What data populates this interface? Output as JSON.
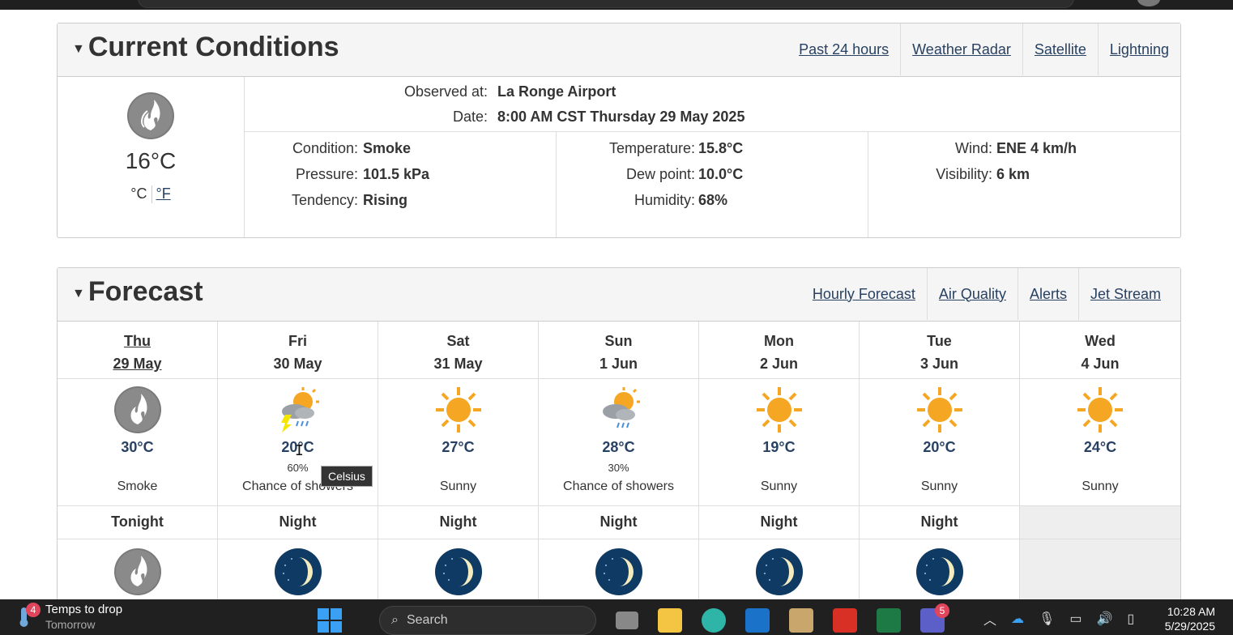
{
  "current": {
    "title": "Current Conditions",
    "links": [
      "Past 24 hours",
      "Weather Radar",
      "Satellite",
      "Lightning"
    ],
    "temp": "16°C",
    "unit_c": "°C",
    "unit_f": "°F",
    "observed_label": "Observed at:",
    "observed_value": "La Ronge Airport",
    "date_label": "Date:",
    "date_value": "8:00 AM CST Thursday 29 May 2025",
    "col1": [
      {
        "label": "Condition:",
        "value": "Smoke"
      },
      {
        "label": "Pressure:",
        "value": "101.5 kPa"
      },
      {
        "label": "Tendency:",
        "value": "Rising"
      }
    ],
    "col2": [
      {
        "label": "Temperature:",
        "value": "15.8°C"
      },
      {
        "label": "Dew point:",
        "value": "10.0°C"
      },
      {
        "label": "Humidity:",
        "value": "68%"
      }
    ],
    "col3": [
      {
        "label": "Wind:",
        "value": "ENE 4 km/h"
      },
      {
        "label": "Visibility:",
        "value": "6 km"
      }
    ]
  },
  "forecast": {
    "title": "Forecast",
    "links": [
      "Hourly Forecast",
      "Air Quality",
      "Alerts",
      "Jet Stream"
    ],
    "days": [
      {
        "day": "Thu",
        "date": "29 May",
        "icon": "smoke-icon",
        "temp": "30°C",
        "pop": "",
        "cond": "Smoke"
      },
      {
        "day": "Fri",
        "date": "30 May",
        "icon": "thunder-showers-icon",
        "temp": "20°C",
        "pop": "60%",
        "cond": "Chance of showers"
      },
      {
        "day": "Sat",
        "date": "31 May",
        "icon": "sun-icon",
        "temp": "27°C",
        "pop": "",
        "cond": "Sunny"
      },
      {
        "day": "Sun",
        "date": "1 Jun",
        "icon": "sun-showers-icon",
        "temp": "28°C",
        "pop": "30%",
        "cond": "Chance of showers"
      },
      {
        "day": "Mon",
        "date": "2 Jun",
        "icon": "sun-icon",
        "temp": "19°C",
        "pop": "",
        "cond": "Sunny"
      },
      {
        "day": "Tue",
        "date": "3 Jun",
        "icon": "sun-icon",
        "temp": "20°C",
        "pop": "",
        "cond": "Sunny"
      },
      {
        "day": "Wed",
        "date": "4 Jun",
        "icon": "sun-icon",
        "temp": "24°C",
        "pop": "",
        "cond": "Sunny"
      }
    ],
    "nights": [
      "Tonight",
      "Night",
      "Night",
      "Night",
      "Night",
      "Night",
      ""
    ],
    "night_icons": [
      "smoke-icon",
      "moon-icon",
      "moon-icon",
      "moon-icon",
      "moon-icon",
      "moon-icon",
      ""
    ],
    "tooltip": "Celsius"
  },
  "taskbar": {
    "widget_badge": "4",
    "widget_title": "Temps to drop",
    "widget_sub": "Tomorrow",
    "search": "Search",
    "teams_badge": "5",
    "time": "10:28 AM",
    "date": "5/29/2025"
  },
  "colors": {
    "accent_link": "#284162",
    "sun": "#F5A623",
    "moon_bg": "#0E3A63",
    "smoke": "#7a7a7a"
  }
}
